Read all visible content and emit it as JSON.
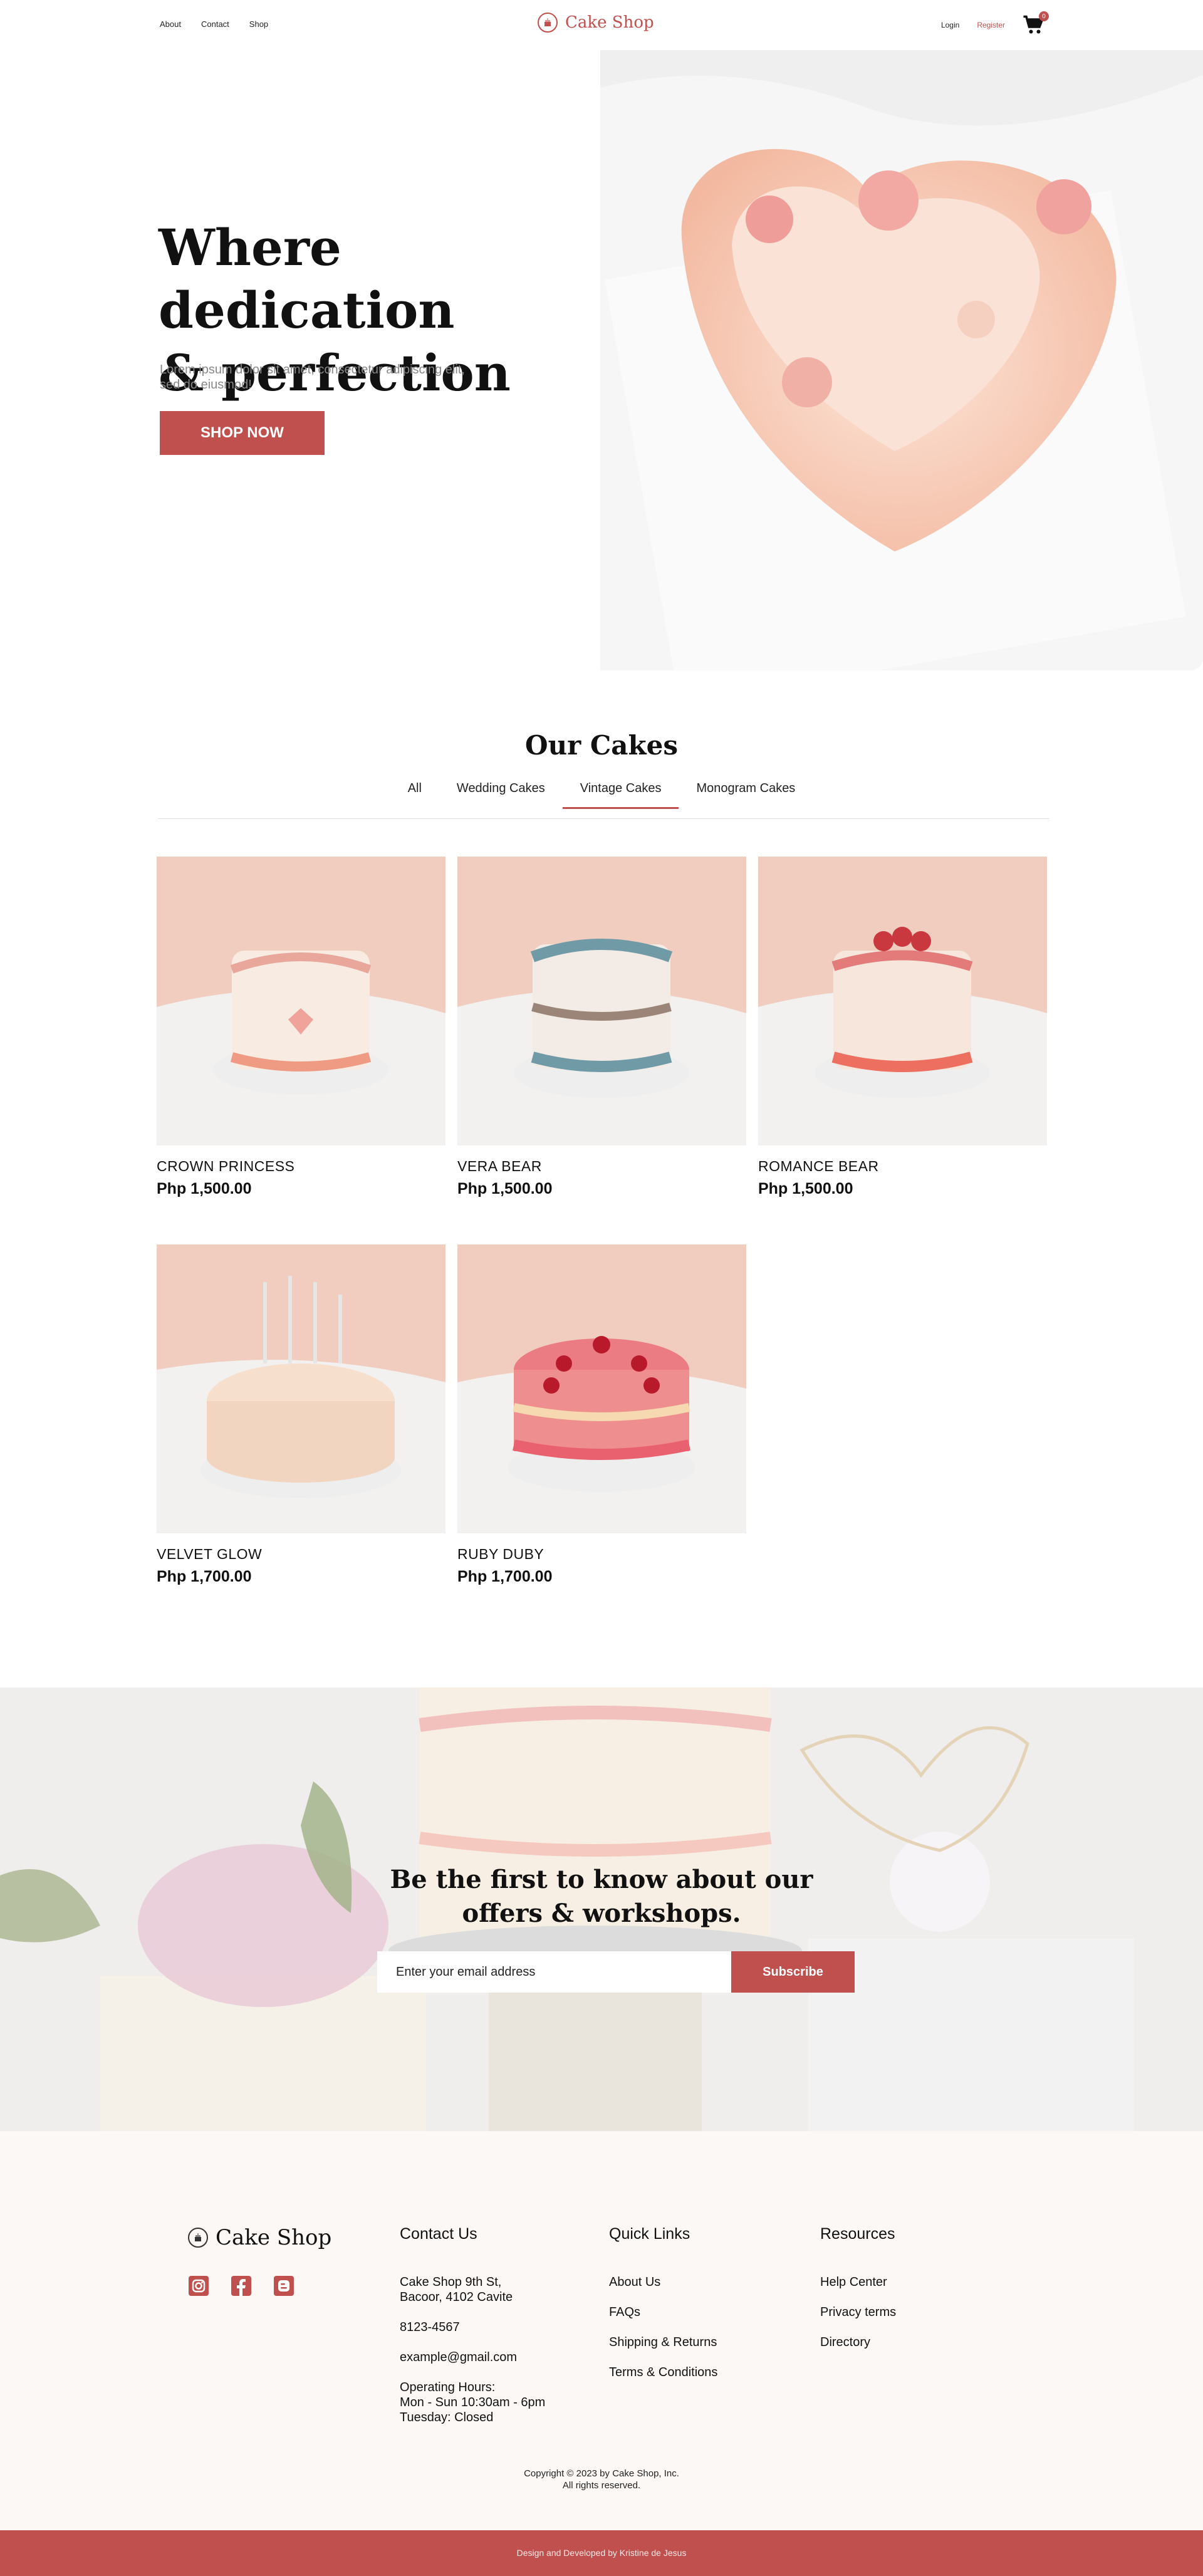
{
  "nav": {
    "links": [
      "About",
      "Contact",
      "Shop"
    ],
    "brand": "Cake Shop",
    "login": "Login",
    "register": "Register",
    "cart_count": "0"
  },
  "hero": {
    "title_line1": "Where dedication",
    "title_line2": "& perfection meet.",
    "subtitle": "Lorem ipsum dolor sit amet, consectetur adipiscing elit, sed do eiusmod!",
    "cta": "SHOP NOW"
  },
  "cakes": {
    "title": "Our Cakes",
    "tabs": [
      "All",
      "Wedding Cakes",
      "Vintage Cakes",
      "Monogram Cakes"
    ],
    "active_tab": "Vintage Cakes",
    "items": [
      {
        "name": "CROWN PRINCESS",
        "price": "Php 1,500.00"
      },
      {
        "name": "VERA BEAR",
        "price": "Php 1,500.00"
      },
      {
        "name": "ROMANCE BEAR",
        "price": "Php 1,500.00"
      },
      {
        "name": "VELVET GLOW",
        "price": "Php 1,700.00"
      },
      {
        "name": "RUBY DUBY",
        "price": "Php 1,700.00"
      }
    ]
  },
  "newsletter": {
    "title_line1": "Be the first to know about our",
    "title_line2": "offers & workshops.",
    "placeholder": "Enter your email address",
    "button": "Subscribe"
  },
  "footer": {
    "brand": "Cake Shop",
    "contact": {
      "heading": "Contact Us",
      "address_line1": "Cake Shop 9th St,",
      "address_line2": "Bacoor, 4102 Cavite",
      "phone": "8123-4567",
      "email": "example@gmail.com",
      "hours_title": "Operating Hours:",
      "hours_line1": "Mon - Sun 10:30am - 6pm",
      "hours_line2": "Tuesday: Closed"
    },
    "quick_links": {
      "heading": "Quick Links",
      "items": [
        "About Us",
        "FAQs",
        "Shipping & Returns",
        "Terms & Conditions"
      ]
    },
    "resources": {
      "heading": "Resources",
      "items": [
        "Help Center",
        "Privacy terms",
        "Directory"
      ]
    },
    "copyright_line1": "Copyright © 2023 by Cake Shop, Inc.",
    "copyright_line2": "All rights reserved.",
    "credit": "Design and Developed by Kristine de Jesus"
  },
  "colors": {
    "accent": "#c0504d",
    "footer_bg": "#fcf8f5"
  }
}
